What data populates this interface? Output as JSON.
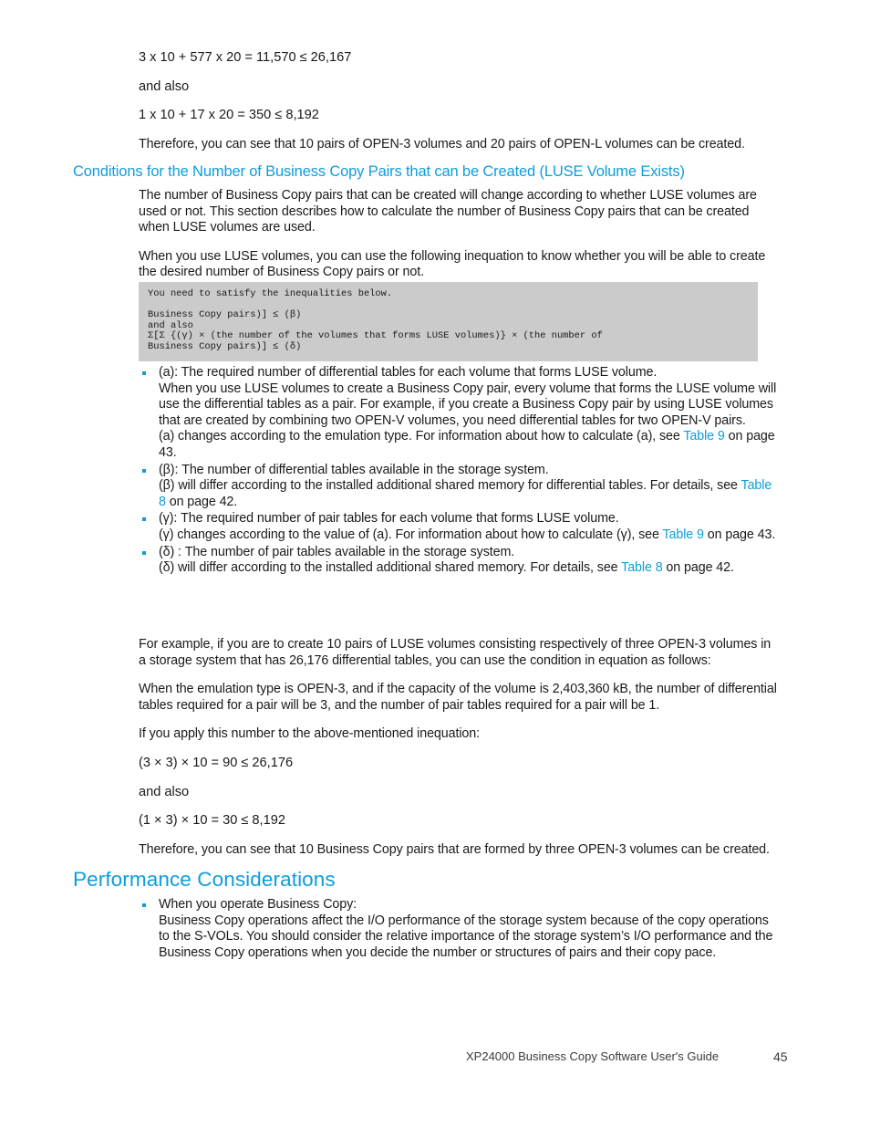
{
  "document": {
    "footer_title": "XP24000 Business Copy Software User's Guide",
    "page_number": "45",
    "accent_color": "#0d9ddb",
    "code_background": "#cbcbcb"
  },
  "top_block": {
    "equation_1": "3 x 10 + 577 x 20 = 11,570 ≤ 26,167",
    "and_also_1": "and also",
    "equation_2": "1 x 10 + 17 x 20 = 350 ≤ 8,192",
    "conclusion": "Therefore, you can see that 10 pairs of OPEN-3 volumes and 20 pairs of OPEN-L volumes can be created."
  },
  "section_luse": {
    "heading": "Conditions for the Number of Business Copy Pairs that can be Created (LUSE Volume Exists)",
    "paragraph_1": "The number of Business Copy pairs that can be created will change according to whether LUSE volumes are used or not.  This section describes how to calculate the number of Business Copy pairs that can be created when LUSE volumes are used.",
    "paragraph_2": "When you use LUSE volumes, you can use the following inequation to know whether you will be able to create the desired number of Business Copy pairs or not.",
    "code": "You need to satisfy the inequalities below.\n\nBusiness Copy pairs)] ≤ (β)\nand also\nΣ[Σ {(γ) × (the number of the volumes that forms LUSE volumes)} × (the number of\nBusiness Copy pairs)] ≤ (δ)",
    "bullets": [
      {
        "line_1": "(a): The required number of differential tables for each volume that forms LUSE volume.",
        "line_2": "When you use LUSE volumes to create a Business Copy pair, every volume that forms the LUSE volume will use the differential tables as a pair.  For example, if you create a Business Copy pair by using LUSE volumes that are created by combining two OPEN-V volumes, you need differential tables for two OPEN-V pairs.",
        "line_3_pre": "(a) changes according to the emulation type.  For information about how to calculate (a), see ",
        "link": "Table 9",
        "line_3_post": " on page 43."
      },
      {
        "line_1": "(β): The number of differential tables available in the storage system.",
        "line_2_pre": "(β) will differ according to the installed additional shared memory for differential tables.  For details, see ",
        "link": "Table 8",
        "line_2_post": " on page 42."
      },
      {
        "line_1": "(γ): The required number of pair tables for each volume that forms LUSE volume.",
        "line_2_pre": "(γ) changes according to the value of (a).  For information about how to calculate (γ), see ",
        "link": "Table 9",
        "line_2_post": " on page 43."
      },
      {
        "line_1": "(δ) : The number of pair tables available in the storage system.",
        "line_2_pre": "(δ) will differ according to the installed additional shared memory.  For details, see ",
        "link": "Table 8",
        "line_2_post": " on page 42."
      }
    ],
    "paragraph_3": "For example, if you are to create 10 pairs of LUSE volumes consisting respectively of three OPEN-3 volumes in a storage system that has 26,176 differential tables, you can use the condition in equation as follows:",
    "paragraph_4": "When the emulation type is OPEN-3, and if the capacity of the volume is 2,403,360 kB, the number of differential tables required for a pair will be 3, and the number of pair tables required for a pair will be 1.",
    "paragraph_5": "If you apply this number to the above-mentioned inequation:",
    "equation_3": "(3 × 3) × 10 = 90 ≤ 26,176",
    "and_also_2": "and also",
    "equation_4": "(1 × 3) × 10 = 30 ≤ 8,192",
    "paragraph_6": "Therefore, you can see that 10 Business Copy pairs that are formed by three OPEN-3 volumes can be created."
  },
  "section_performance": {
    "heading": "Performance Considerations",
    "bullets": [
      {
        "line_1": "When you operate Business Copy:",
        "line_2": "Business Copy operations affect the I/O performance of the storage system because of the copy operations to the S-VOLs.  You should consider the relative importance of the storage system’s I/O performance and the Business Copy operations when you decide the number or structures of pairs and their copy pace."
      }
    ]
  }
}
